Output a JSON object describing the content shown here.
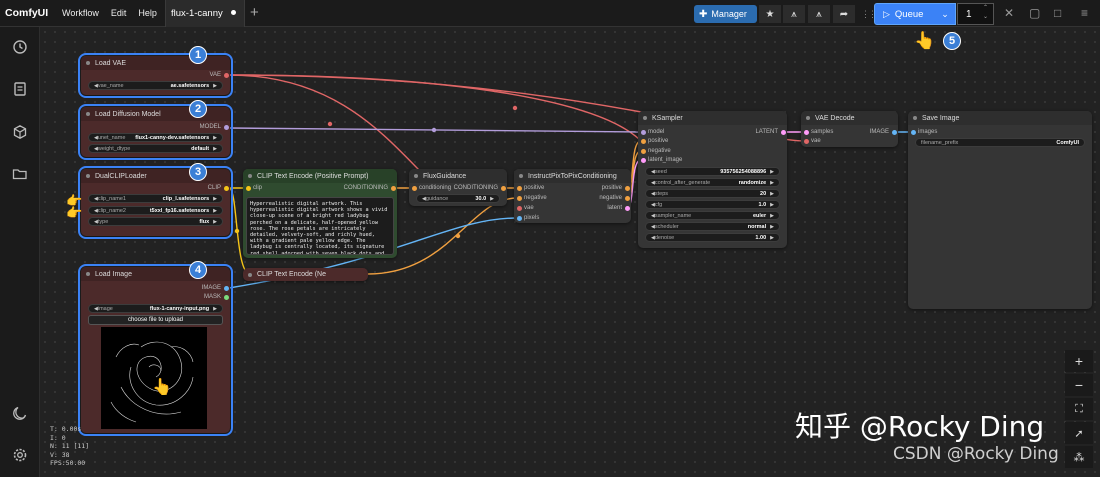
{
  "app": {
    "brand": "ComfyUI",
    "menu": [
      "Workflow",
      "Edit",
      "Help"
    ],
    "tab_title": "flux-1-canny",
    "new_tab": "+"
  },
  "toolbar": {
    "manager_label": "Manager",
    "queue_label": "Queue",
    "queue_count": "1"
  },
  "sidebar_icons": [
    "history-icon",
    "node-library-icon",
    "model-library-icon",
    "workflows-icon",
    "theme-toggle-icon",
    "settings-icon"
  ],
  "nodes": {
    "load_vae": {
      "title": "Load VAE",
      "out": "VAE",
      "w_name": "vae_name",
      "w_val": "ae.safetensors"
    },
    "load_diffusion": {
      "title": "Load Diffusion Model",
      "out": "MODEL",
      "w1_name": "unet_name",
      "w1_val": "flux1-canny-dev.safetensors",
      "w2_name": "weight_dtype",
      "w2_val": "default"
    },
    "dual_clip": {
      "title": "DualCLIPLoader",
      "out": "CLIP",
      "w1_name": "clip_name1",
      "w1_val": "clip_l.safetensors",
      "w2_name": "clip_name2",
      "w2_val": "t5xxl_fp16.safetensors",
      "w3_name": "type",
      "w3_val": "flux"
    },
    "clip_pos": {
      "title": "CLIP Text Encode (Positive Prompt)",
      "in": "clip",
      "out": "CONDITIONING",
      "text": "Hyperrealistic digital artwork. This hyperrealistic digital artwork shows a vivid close-up scene of a bright red ladybug perched on a delicate, half-opened yellow rose. The rose petals are intricately detailed, velvety-soft, and richly hued, with a gradient pale yellow edge. The ladybug is centrally located, its signature red shell adorned with seven black dots and a small yellow-orange head. Dew drops"
    },
    "clip_neg": {
      "title": "CLIP Text Encode (Ne"
    },
    "load_image": {
      "title": "Load Image",
      "out1": "IMAGE",
      "out2": "MASK",
      "w_name": "image",
      "w_val": "flux-1-canny-input.png",
      "upload": "choose file to upload"
    },
    "flux_guidance": {
      "title": "FluxGuidance",
      "in": "conditioning",
      "out": "CONDITIONING",
      "w_name": "guidance",
      "w_val": "30.0"
    },
    "instruct": {
      "title": "InstructPixToPixConditioning",
      "in": [
        "positive",
        "negative",
        "vae",
        "pixels"
      ],
      "out": [
        "positive",
        "negative",
        "latent"
      ]
    },
    "ksampler": {
      "title": "KSampler",
      "in": [
        "model",
        "positive",
        "negative",
        "latent_image"
      ],
      "out": "LATENT",
      "widgets": [
        {
          "name": "seed",
          "val": "935756254088896"
        },
        {
          "name": "control_after_generate",
          "val": "randomize"
        },
        {
          "name": "steps",
          "val": "20"
        },
        {
          "name": "cfg",
          "val": "1.0"
        },
        {
          "name": "sampler_name",
          "val": "euler"
        },
        {
          "name": "scheduler",
          "val": "normal"
        },
        {
          "name": "denoise",
          "val": "1.00"
        }
      ]
    },
    "vae_decode": {
      "title": "VAE Decode",
      "in": [
        "samples",
        "vae"
      ],
      "out": "IMAGE"
    },
    "save_image": {
      "title": "Save Image",
      "in": "images",
      "w_name": "filename_prefix",
      "w_val": "ComfyUI"
    }
  },
  "badges": [
    "1",
    "2",
    "3",
    "4",
    "5"
  ],
  "stats": [
    "T: 0.00s",
    "I: 0",
    "N: 11 [11]",
    "V: 38",
    "FPS:50.00"
  ],
  "zoom": [
    "+",
    "−",
    "⛶",
    "➚",
    "⁂"
  ],
  "watermark": {
    "line1": "知乎 @Rocky Ding",
    "line2": "CSDN @Rocky Ding"
  },
  "colors": {
    "accent": "#3b82f6",
    "vae_link": "#e06666",
    "model_link": "#b39ddb",
    "clip_link": "#f5c518",
    "cond_link": "#f0a040",
    "image_link": "#64b5f6",
    "latent_link": "#ff9cf9"
  }
}
